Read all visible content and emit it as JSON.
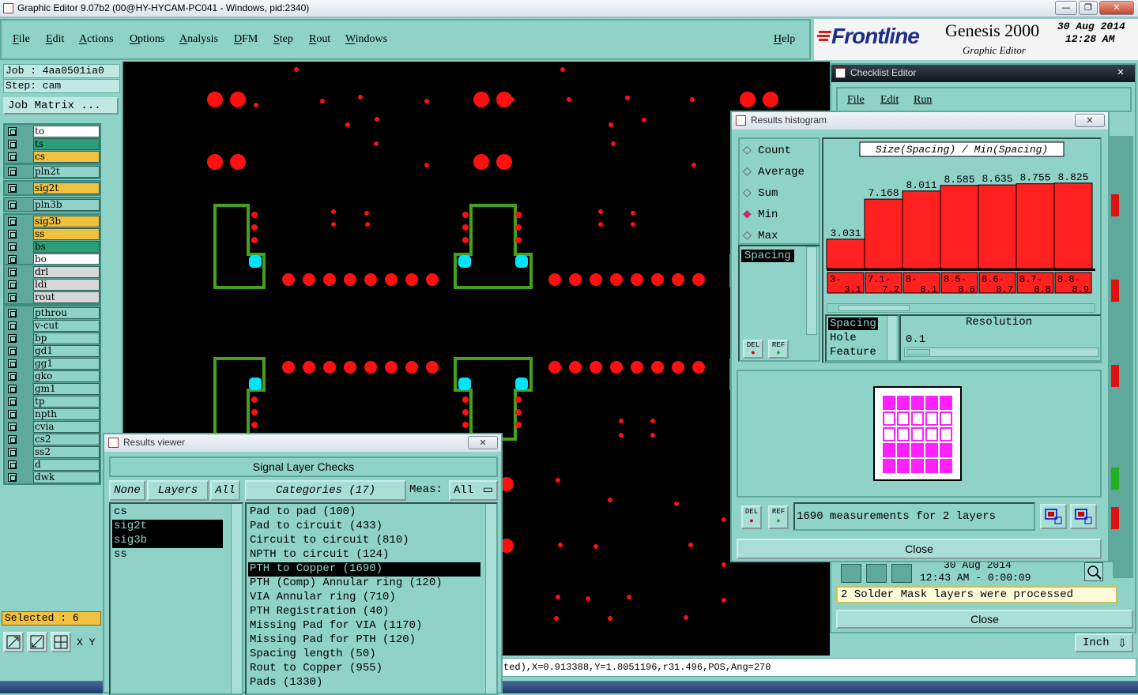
{
  "window": {
    "title": "Graphic Editor 9.07b2 (00@HY-HYCAM-PC041 - Windows, pid:2340)",
    "buttons": [
      "—",
      "❐",
      "✕"
    ]
  },
  "menu": {
    "items": [
      "File",
      "Edit",
      "Actions",
      "Options",
      "Analysis",
      "DFM",
      "Step",
      "Rout",
      "Windows"
    ],
    "help": "Help"
  },
  "brand": {
    "logo": "Frontline",
    "product": "Genesis 2000",
    "subtitle": "Graphic Editor",
    "date": "30 Aug 2014",
    "time": "12:28 AM"
  },
  "left": {
    "job": "Job : 4aa0501ia0",
    "step": "Step: cam",
    "job_matrix": "Job Matrix ...",
    "selected": "Selected : 6",
    "xy": "X Y",
    "groups": [
      [
        {
          "name": "to",
          "color": "#ffffff"
        },
        {
          "name": "ts",
          "color": "#2e9e78"
        },
        {
          "name": "cs",
          "color": "#f0c040"
        }
      ],
      [
        {
          "name": "pln2t",
          "color": "#8fd2c8"
        }
      ],
      [
        {
          "name": "sig2t",
          "color": "#f0c040"
        }
      ],
      [
        {
          "name": "pln3b",
          "color": "#8fd2c8"
        }
      ],
      [
        {
          "name": "sig3b",
          "color": "#f0c040"
        },
        {
          "name": "ss",
          "color": "#f0c040"
        },
        {
          "name": "bs",
          "color": "#2e9e78"
        },
        {
          "name": "bo",
          "color": "#ffffff"
        }
      ],
      [
        {
          "name": "drl",
          "color": "#d8d8d8"
        },
        {
          "name": "ldi",
          "color": "#d8d8d8"
        },
        {
          "name": "rout",
          "color": "#d8d8d8"
        }
      ],
      [
        {
          "name": "pthrou",
          "color": "#8fd2c8"
        },
        {
          "name": "v-cut",
          "color": "#8fd2c8"
        },
        {
          "name": "bp",
          "color": "#8fd2c8"
        },
        {
          "name": "gd1",
          "color": "#8fd2c8"
        },
        {
          "name": "gg1",
          "color": "#8fd2c8"
        },
        {
          "name": "gko",
          "color": "#8fd2c8"
        },
        {
          "name": "gm1",
          "color": "#8fd2c8"
        },
        {
          "name": "tp",
          "color": "#8fd2c8"
        },
        {
          "name": "npth",
          "color": "#8fd2c8"
        },
        {
          "name": "cvia",
          "color": "#8fd2c8"
        },
        {
          "name": "cs2",
          "color": "#8fd2c8"
        },
        {
          "name": "ss2",
          "color": "#8fd2c8"
        },
        {
          "name": "d",
          "color": "#8fd2c8"
        },
        {
          "name": "dwk",
          "color": "#8fd2c8"
        }
      ]
    ]
  },
  "status_text": "ted),X=0.913388,Y=1.8051196,r31.496,POS,Ang=270",
  "results_viewer": {
    "title": "Results viewer",
    "header": "Signal Layer Checks",
    "none": "None",
    "layers": "Layers",
    "all": "All",
    "categories": "Categories (17)",
    "meas_label": "Meas:",
    "meas_value": "All",
    "layer_list": [
      "cs",
      "sig2t",
      "sig3b",
      "ss"
    ],
    "selected_layers": [
      "sig2t",
      "sig3b"
    ],
    "category_list": [
      "Pad to pad (100)",
      "Pad to circuit (433)",
      "Circuit to circuit (810)",
      "NPTH to circuit (124)",
      "PTH to Copper (1690)",
      "PTH (Comp) Annular ring (120)",
      "VIA Annular ring (710)",
      "PTH Registration (40)",
      "Missing Pad for VIA (1170)",
      "Missing Pad for PTH (120)",
      "Spacing length (50)",
      "Rout to Copper (955)",
      "Pads (1330)"
    ],
    "selected_category": "PTH to Copper (1690)"
  },
  "histogram": {
    "title": "Results histogram",
    "modes": [
      "Count",
      "Average",
      "Sum",
      "Min",
      "Max"
    ],
    "selected_mode": "Min",
    "list_item": "Spacing",
    "del": "DEL",
    "ref": "REF",
    "chart_title": "Size(Spacing) / Min(Spacing)",
    "resolution_label": "Resolution",
    "resolution_value": "0.1",
    "feature_list": [
      "Spacing",
      "Hole",
      "Feature"
    ],
    "measurements": "1690 measurements for 2 layers",
    "close": "Close",
    "chart_color": "#ff2020"
  },
  "chart_data": {
    "type": "bar",
    "title": "Size(Spacing) / Min(Spacing)",
    "categories": [
      "3-\n3.1",
      "7.1-\n7.2",
      "8-\n8.1",
      "8.5-\n8.6",
      "8.6-\n8.7",
      "8.7-\n8.8",
      "8.8-\n8.9"
    ],
    "category_labels_top": [
      "3-",
      "7.1-",
      "8-",
      "8.5-",
      "8.6-",
      "8.7-",
      "8.8-"
    ],
    "category_labels_bottom": [
      "3.1",
      "7.2",
      "8.1",
      "8.6",
      "8.7",
      "8.8",
      "8.9"
    ],
    "values": [
      3.031,
      7.168,
      8.011,
      8.585,
      8.635,
      8.755,
      8.825
    ],
    "value_labels": [
      "3.031",
      "7.168",
      "8.011",
      "8.585",
      "8.635",
      "8.755",
      "8.825"
    ],
    "ylim": [
      0,
      9.3
    ]
  },
  "checklist": {
    "title": "Checklist Editor",
    "menu": [
      "File",
      "Edit",
      "Run"
    ],
    "date": "30 Aug 2014",
    "time": "12:43 AM - 0:00:09",
    "message": "2 Solder Mask layers were processed",
    "close": "Close",
    "units": "Inch"
  }
}
